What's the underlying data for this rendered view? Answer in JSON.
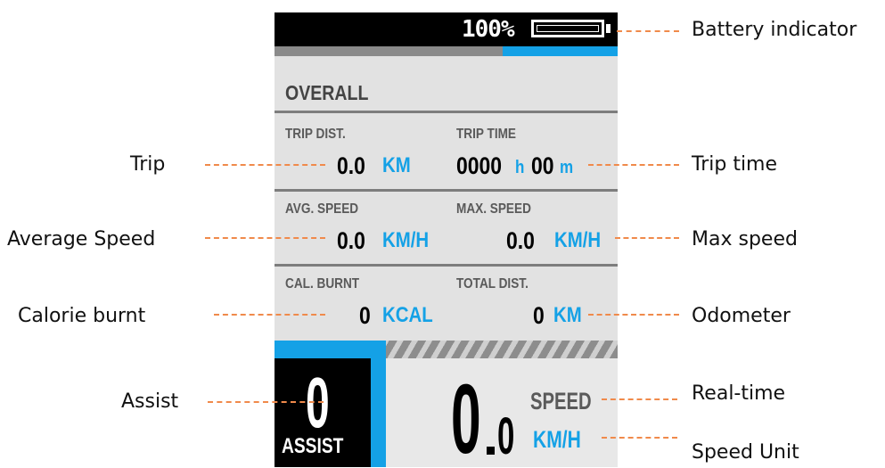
{
  "annotations": {
    "battery": "Battery indicator",
    "trip": "Trip",
    "trip_time": "Trip time",
    "avg_speed": "Average  Speed",
    "max_speed": "Max speed",
    "calorie": "Calorie burnt",
    "odometer": "Odometer",
    "assist": "Assist",
    "realtime": "Real-time",
    "speed_unit": "Speed Unit"
  },
  "display": {
    "battery_percent": "100%",
    "section_title": "OVERALL",
    "trip_dist": {
      "label": "TRIP DIST.",
      "value": "0.0",
      "unit": "KM"
    },
    "trip_time": {
      "label": "TRIP TIME",
      "hours": "0000",
      "h": "h",
      "minutes": "00",
      "m": "m"
    },
    "avg_speed": {
      "label": "AVG. SPEED",
      "value": "0.0",
      "unit": "KM/H"
    },
    "max_speed": {
      "label": "MAX. SPEED",
      "value": "0.0",
      "unit": "KM/H"
    },
    "calories": {
      "label": "CAL. BURNT",
      "value": "0",
      "unit": "KCAL"
    },
    "total_dist": {
      "label": "TOTAL DIST.",
      "value": "0",
      "unit": "KM"
    },
    "assist": {
      "value": "0",
      "label": "ASSIST"
    },
    "speed": {
      "integer": "0",
      "decimal": "0",
      "label": "SPEED",
      "unit": "KM/H"
    }
  },
  "colors": {
    "accent": "#14a1e6",
    "leader": "#f08a4b",
    "panel": "#e2e2e2",
    "topbar": "#000000"
  }
}
